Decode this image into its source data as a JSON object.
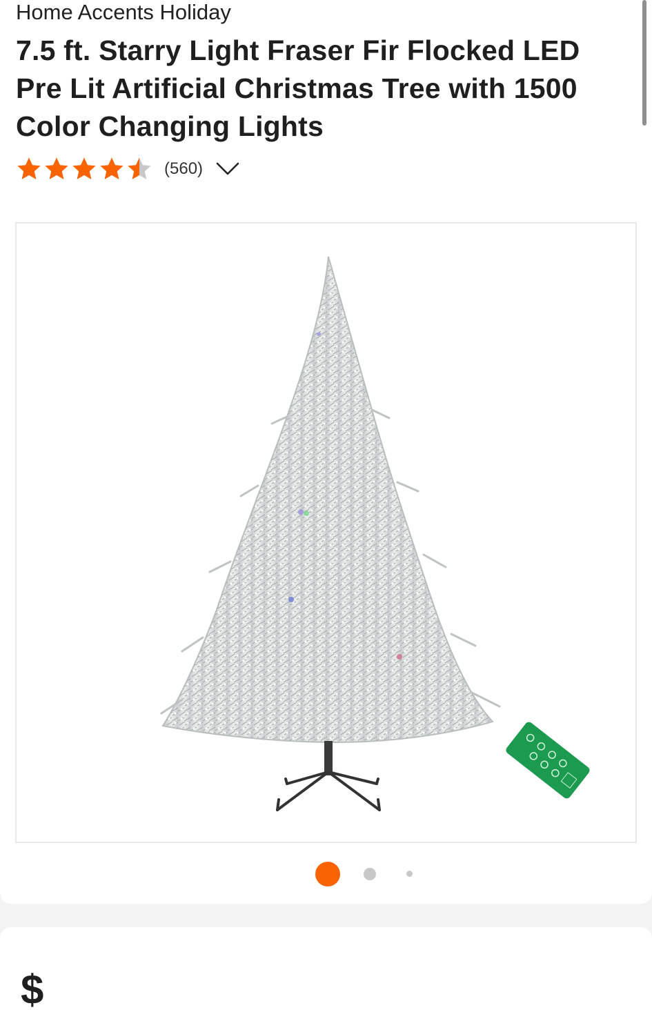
{
  "product": {
    "brand": "Home Accents Holiday",
    "title": "7.5 ft. Starry Light Fraser Fir Flocked LED Pre Lit Artificial Christmas Tree with 1500 Color Changing Lights",
    "rating": 4.5,
    "review_count": "(560)",
    "image_alt": "Flocked artificial Christmas tree with remote control"
  },
  "carousel": {
    "total": 3,
    "active_index": 0
  },
  "price": {
    "partial_text": "$"
  },
  "colors": {
    "accent": "#f96302",
    "star_fill": "#f96302",
    "star_empty": "#c8c8c8",
    "remote": "#1c9a4f"
  },
  "icons": {
    "rating_star": "star-icon",
    "expand": "chevron-down-icon"
  }
}
